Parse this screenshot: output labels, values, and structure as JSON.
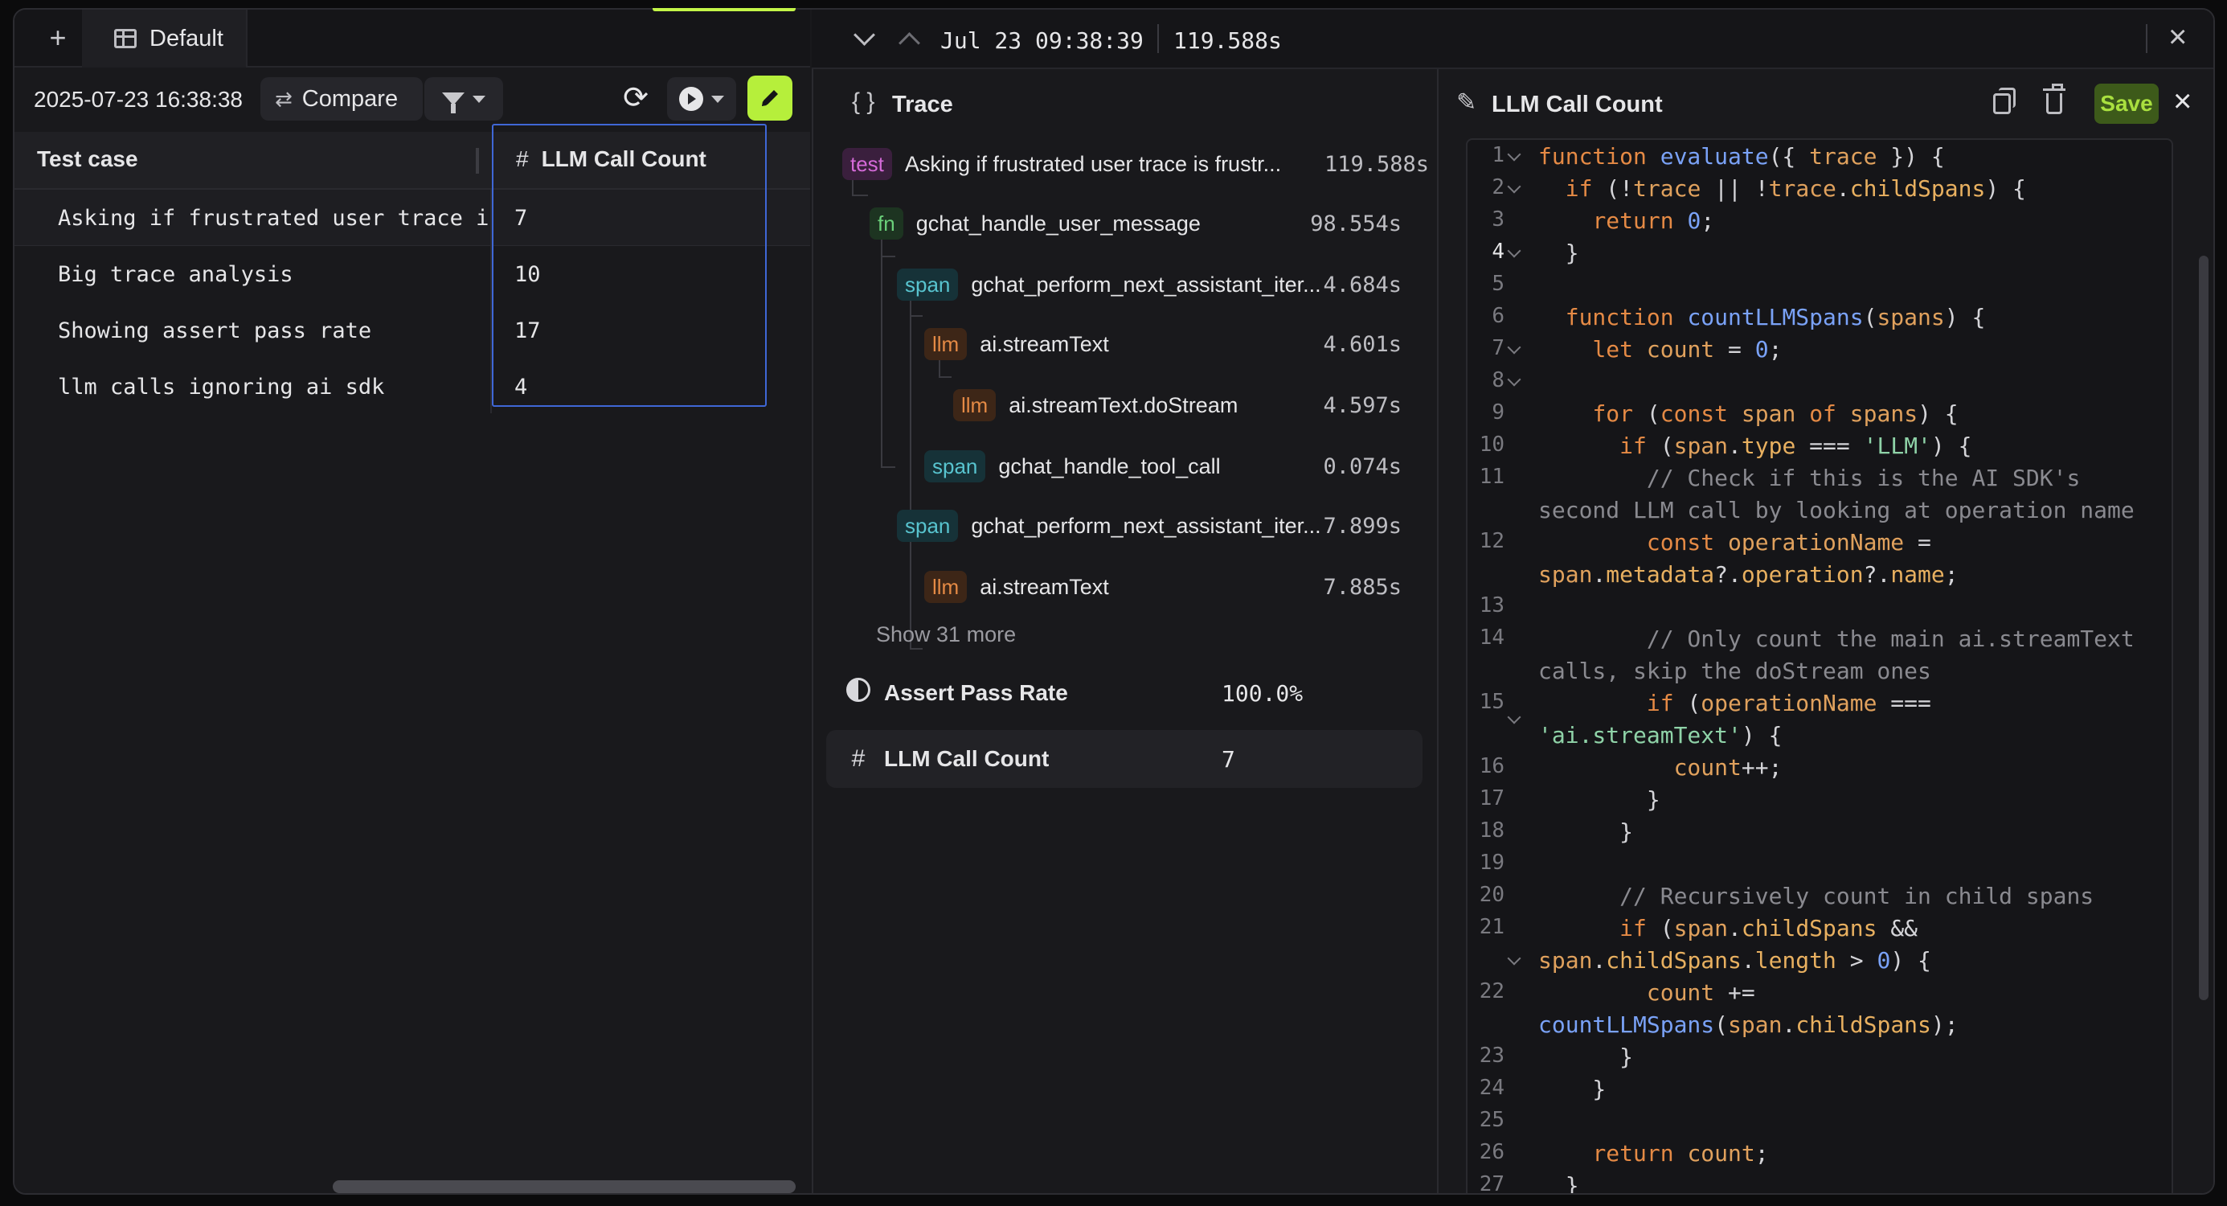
{
  "tabs": {
    "new_icon": "plus-icon",
    "current": "Default"
  },
  "left_toolbar": {
    "run_timestamp": "2025-07-23 16:38:38",
    "compare_label": "Compare"
  },
  "table": {
    "columns": {
      "test_case": "Test case",
      "llm_call_count": "LLM Call Count"
    },
    "rows": [
      {
        "name": "Asking if frustrated user trace i",
        "value": "7"
      },
      {
        "name": "Big trace analysis",
        "value": "10"
      },
      {
        "name": "Showing assert pass rate",
        "value": "17"
      },
      {
        "name": "llm calls ignoring ai sdk",
        "value": "4"
      }
    ]
  },
  "topbar": {
    "timestamp": "Jul 23 09:38:39",
    "duration": "119.588s"
  },
  "trace": {
    "title": "Trace",
    "nodes": [
      {
        "badge": "test",
        "name": "Asking if frustrated user trace is frustr...",
        "duration": "119.588s"
      },
      {
        "badge": "fn",
        "name": "gchat_handle_user_message",
        "duration": "98.554s"
      },
      {
        "badge": "span",
        "name": "gchat_perform_next_assistant_iter...",
        "duration": "4.684s"
      },
      {
        "badge": "llm",
        "name": "ai.streamText",
        "duration": "4.601s"
      },
      {
        "badge": "llm",
        "name": "ai.streamText.doStream",
        "duration": "4.597s"
      },
      {
        "badge": "span",
        "name": "gchat_handle_tool_call",
        "duration": "0.074s"
      },
      {
        "badge": "span",
        "name": "gchat_perform_next_assistant_iter...",
        "duration": "7.899s"
      },
      {
        "badge": "llm",
        "name": "ai.streamText",
        "duration": "7.885s"
      }
    ],
    "show_more": "Show 31 more"
  },
  "scores": [
    {
      "name": "Assert Pass Rate",
      "value": "100.0%"
    },
    {
      "name": "LLM Call Count",
      "value": "7"
    }
  ],
  "editor": {
    "title": "LLM Call Count",
    "save_label": "Save",
    "line_numbers": [
      "1",
      "2",
      "3",
      "4",
      "5",
      "6",
      "7",
      "8",
      "9",
      "10",
      "11",
      "",
      "12",
      "",
      "13",
      "14",
      "",
      "15",
      "",
      "16",
      "17",
      "18",
      "19",
      "20",
      "21",
      "",
      "22",
      "",
      "23",
      "24",
      "25",
      "26",
      "27"
    ]
  },
  "colors": {
    "accent": "#b6ef3b",
    "selection_border": "#3f67d6",
    "test_badge": "#d46ad8",
    "fn_badge": "#6bd17a",
    "span_badge": "#58c4cf",
    "llm_badge": "#e58a45"
  }
}
